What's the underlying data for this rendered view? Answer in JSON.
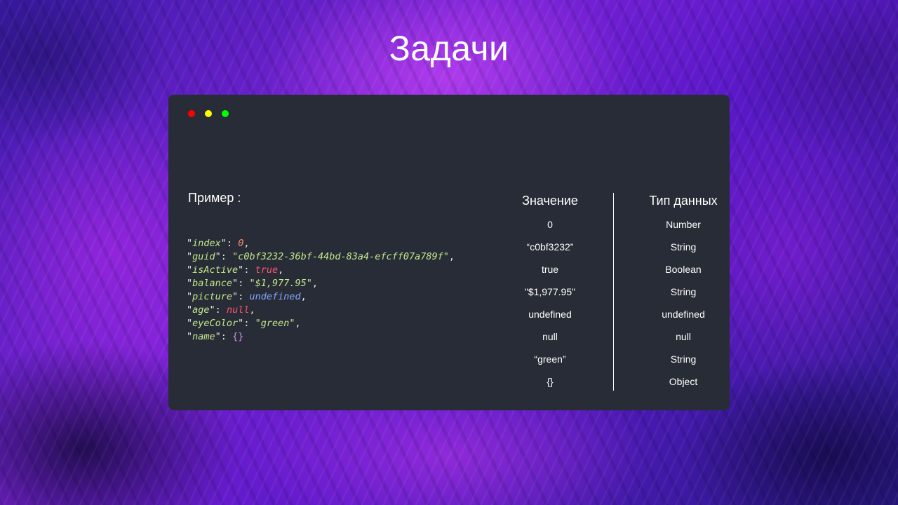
{
  "page": {
    "title": "Задачи"
  },
  "window": {
    "dots": [
      {
        "name": "close-dot",
        "color": "#ff0000"
      },
      {
        "name": "minimize-dot",
        "color": "#ffff00"
      },
      {
        "name": "maximize-dot",
        "color": "#00ff00"
      }
    ]
  },
  "example": {
    "label": "Пример :",
    "code": [
      {
        "key": "index",
        "sep": ": ",
        "value": "0",
        "type": "num",
        "trail": ","
      },
      {
        "key": "guid",
        "sep": ": ",
        "value": "\"c0bf3232-36bf-44bd-83a4-efcff07a789f\"",
        "type": "str",
        "trail": ","
      },
      {
        "key": "isActive",
        "sep": ": ",
        "value": "true",
        "type": "bool",
        "trail": ","
      },
      {
        "key": "balance",
        "sep": ": ",
        "value": "\"$1,977.95\"",
        "type": "str",
        "trail": ","
      },
      {
        "key": "picture",
        "sep": ": ",
        "value": "undefined",
        "type": "undef",
        "trail": ","
      },
      {
        "key": "age",
        "sep": ": ",
        "value": "null",
        "type": "nul",
        "trail": ","
      },
      {
        "key": "eyeColor",
        "sep": ": ",
        "value": "\"green\"",
        "type": "str",
        "trail": ","
      },
      {
        "key": "name",
        "sep": ": ",
        "value": "{}",
        "type": "obj",
        "trail": ""
      }
    ]
  },
  "table": {
    "value_header": "Значение",
    "type_header": "Тип данных",
    "values": [
      "0",
      "“c0bf3232”",
      "true",
      "\"$1,977.95\"",
      "undefined",
      "null",
      "“green”",
      "{}"
    ],
    "types": [
      "Number",
      "String",
      "Boolean",
      "String",
      "undefined",
      "null",
      "String",
      "Object"
    ]
  }
}
